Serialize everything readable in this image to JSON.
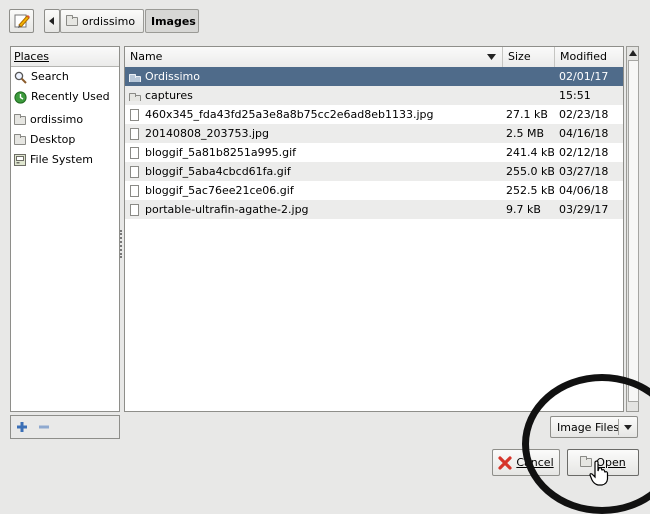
{
  "toolbar": {
    "edit_icon": "pencil-icon",
    "back_icon": "left-arrow-icon"
  },
  "path": [
    {
      "label": "ordissimo",
      "icon": "folder-icon"
    },
    {
      "label": "Images"
    }
  ],
  "places": {
    "header": "Places",
    "items": [
      {
        "label": "Search",
        "icon": "search-icon"
      },
      {
        "label": "Recently Used",
        "icon": "clock-icon"
      },
      {
        "label": "ordissimo",
        "icon": "folder-icon"
      },
      {
        "label": "Desktop",
        "icon": "folder-icon"
      },
      {
        "label": "File System",
        "icon": "drive-icon"
      }
    ]
  },
  "columns": {
    "name": "Name",
    "size": "Size",
    "modified": "Modified"
  },
  "files": [
    {
      "name": "Ordissimo",
      "size": "",
      "modified": "02/01/17",
      "type": "folder",
      "selected": true
    },
    {
      "name": "captures",
      "size": "",
      "modified": "15:51",
      "type": "folder"
    },
    {
      "name": "460x345_fda43fd25a3e8a8b75cc2e6ad8eb1133.jpg",
      "size": "27.1 kB",
      "modified": "02/23/18",
      "type": "file"
    },
    {
      "name": "20140808_203753.jpg",
      "size": "2.5 MB",
      "modified": "04/16/18",
      "type": "file"
    },
    {
      "name": "bloggif_5a81b8251a995.gif",
      "size": "241.4 kB",
      "modified": "02/12/18",
      "type": "file"
    },
    {
      "name": "bloggif_5aba4cbcd61fa.gif",
      "size": "255.0 kB",
      "modified": "03/27/18",
      "type": "file"
    },
    {
      "name": "bloggif_5ac76ee21ce06.gif",
      "size": "252.5 kB",
      "modified": "04/06/18",
      "type": "file"
    },
    {
      "name": "portable-ultrafin-agathe-2.jpg",
      "size": "9.7 kB",
      "modified": "03/29/17",
      "type": "file"
    }
  ],
  "filter": {
    "label": "Image Files"
  },
  "buttons": {
    "cancel": "Cancel",
    "open": "Open"
  },
  "colors": {
    "selection": "#4f6b8a"
  }
}
